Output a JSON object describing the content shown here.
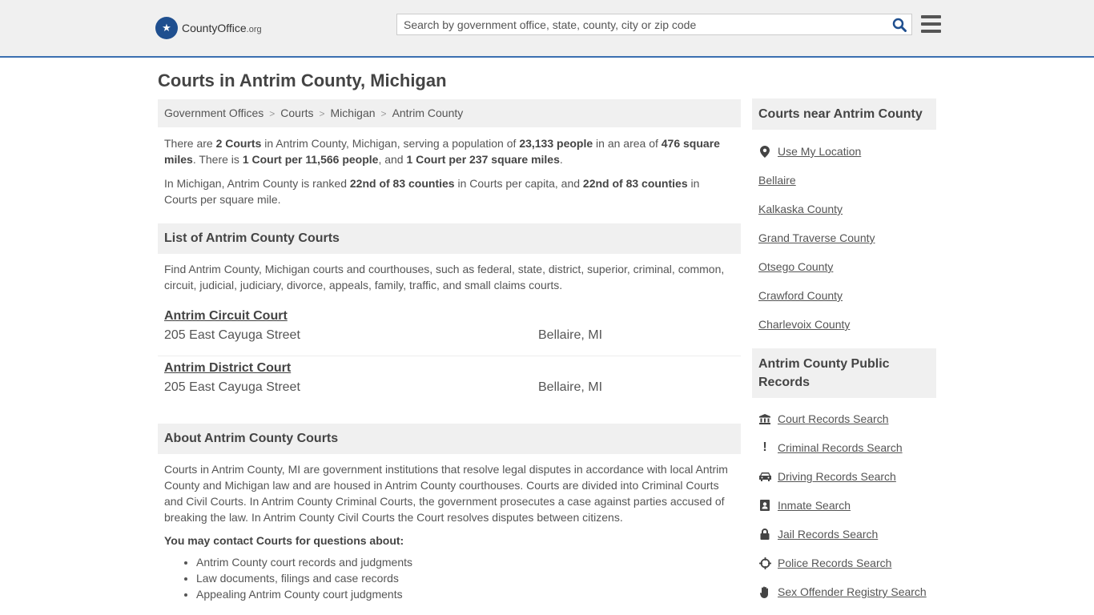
{
  "header": {
    "logo_text_bold": "CountyOffice",
    "logo_text_suffix": ".org",
    "search_placeholder": "Search by government office, state, county, city or zip code"
  },
  "page_title": "Courts in Antrim County, Michigan",
  "breadcrumb": [
    "Government Offices",
    "Courts",
    "Michigan",
    "Antrim County"
  ],
  "intro": {
    "p1": [
      "There are ",
      "2 Courts",
      " in Antrim County, Michigan, serving a population of ",
      "23,133 people",
      " in an area of ",
      "476 square miles",
      ". There is ",
      "1 Court per 11,566 people",
      ", and ",
      "1 Court per 237 square miles",
      "."
    ],
    "p2": [
      "In Michigan, Antrim County is ranked ",
      "22nd of 83 counties",
      " in Courts per capita, and ",
      "22nd of 83 counties",
      " in Courts per square mile."
    ]
  },
  "list_section": {
    "title": "List of Antrim County Courts",
    "desc": "Find Antrim County, Michigan courts and courthouses, such as federal, state, district, superior, criminal, common, circuit, judicial, judiciary, divorce, appeals, family, traffic, and small claims courts.",
    "courts": [
      {
        "name": "Antrim Circuit Court",
        "address": "205 East Cayuga Street",
        "city": "Bellaire, MI"
      },
      {
        "name": "Antrim District Court",
        "address": "205 East Cayuga Street",
        "city": "Bellaire, MI"
      }
    ]
  },
  "about_section": {
    "title": "About Antrim County Courts",
    "text": "Courts in Antrim County, MI are government institutions that resolve legal disputes in accordance with local Antrim County and Michigan law and are housed in Antrim County courthouses. Courts are divided into Criminal Courts and Civil Courts. In Antrim County Criminal Courts, the government prosecutes a case against parties accused of breaking the law. In Antrim County Civil Courts the Court resolves disputes between citizens.",
    "contact_title": "You may contact Courts for questions about:",
    "questions": [
      "Antrim County court records and judgments",
      "Law documents, filings and case records",
      "Appealing Antrim County court judgments"
    ]
  },
  "sidebar": {
    "nearby_title": "Courts near Antrim County",
    "nearby": [
      "Use My Location",
      "Bellaire",
      "Kalkaska County",
      "Grand Traverse County",
      "Otsego County",
      "Crawford County",
      "Charlevoix County"
    ],
    "records_title": "Antrim County Public Records",
    "records": [
      {
        "label": "Court Records Search",
        "icon": "courthouse-icon"
      },
      {
        "label": "Criminal Records Search",
        "icon": "exclamation-icon"
      },
      {
        "label": "Driving Records Search",
        "icon": "car-icon"
      },
      {
        "label": "Inmate Search",
        "icon": "id-badge-icon"
      },
      {
        "label": "Jail Records Search",
        "icon": "lock-icon"
      },
      {
        "label": "Police Records Search",
        "icon": "crosshair-icon"
      },
      {
        "label": "Sex Offender Registry Search",
        "icon": "hand-icon"
      }
    ]
  }
}
